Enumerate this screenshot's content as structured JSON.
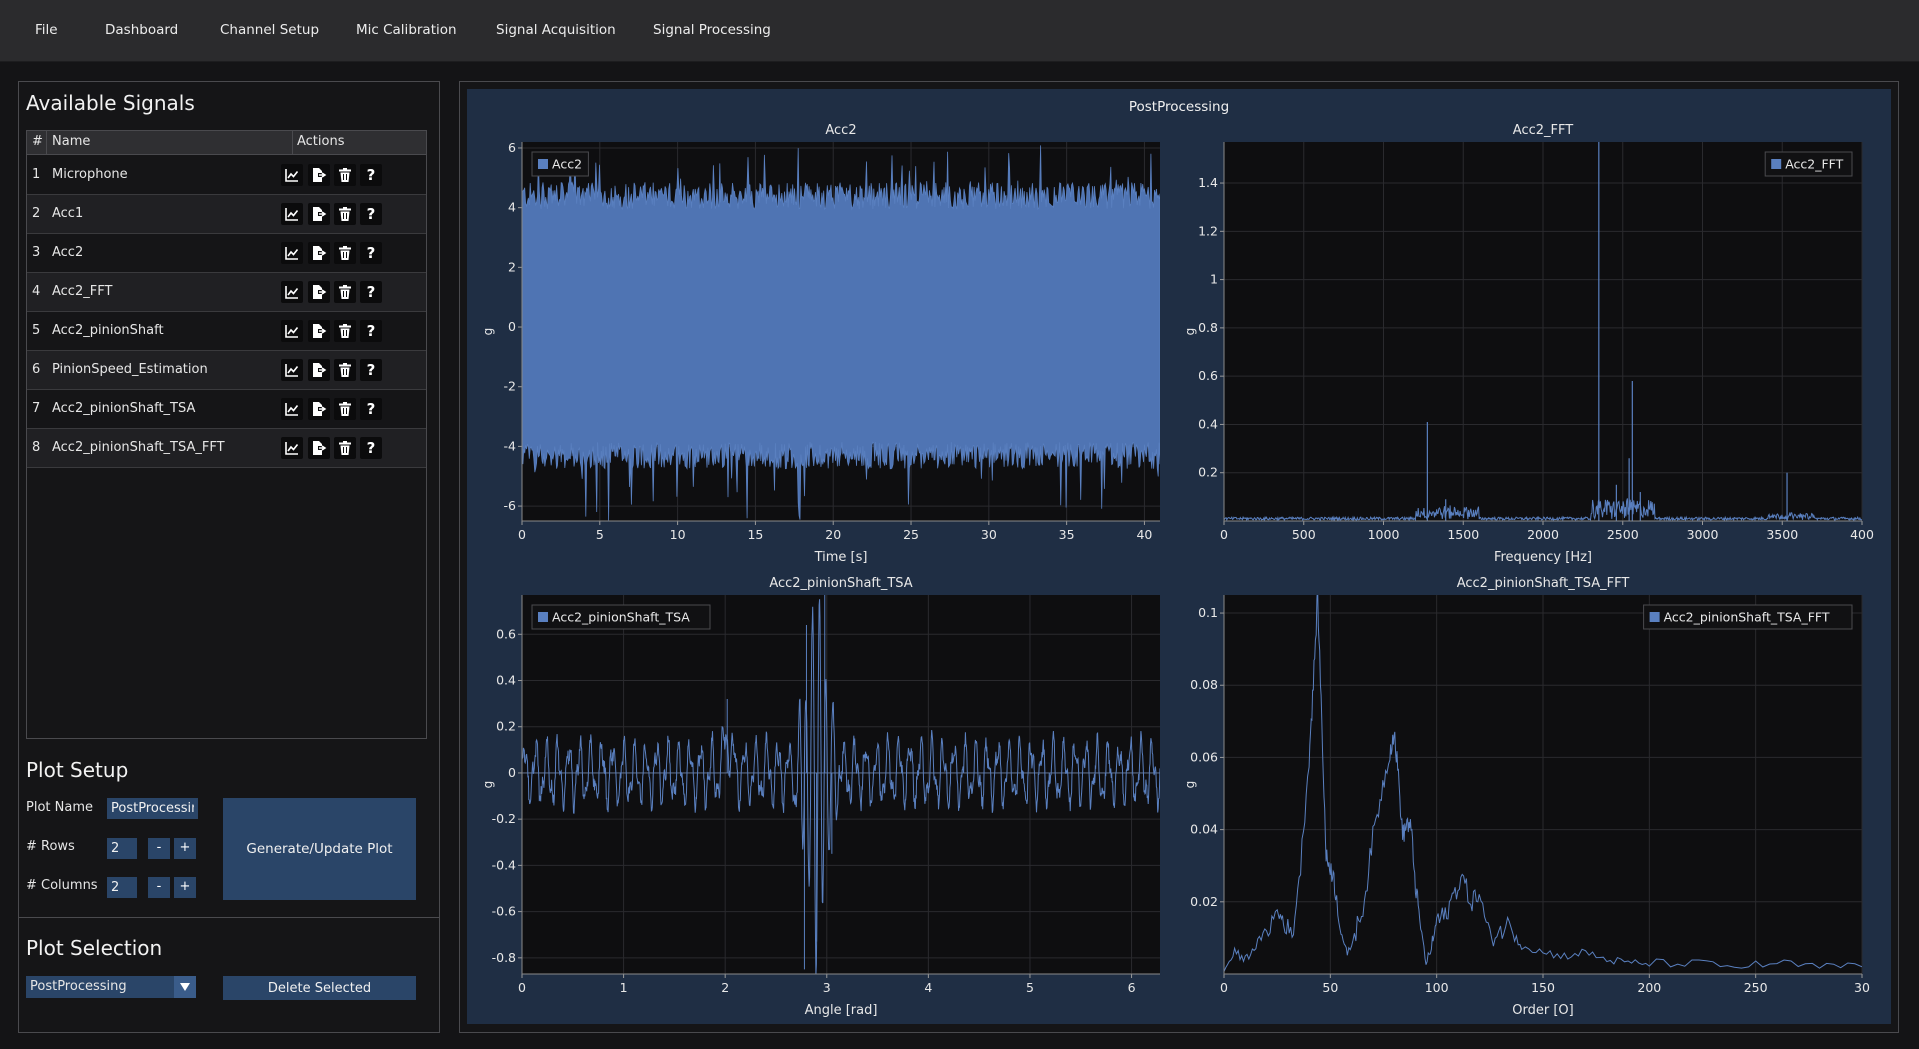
{
  "menu": [
    "File",
    "Dashboard",
    "Channel Setup",
    "Mic Calibration",
    "Signal Acquisition",
    "Signal Processing"
  ],
  "signals": {
    "title": "Available Signals",
    "columns": {
      "num": "#",
      "name": "Name",
      "actions": "Actions"
    },
    "rows": [
      {
        "idx": "1",
        "name": "Microphone"
      },
      {
        "idx": "2",
        "name": "Acc1"
      },
      {
        "idx": "3",
        "name": "Acc2"
      },
      {
        "idx": "4",
        "name": "Acc2_FFT"
      },
      {
        "idx": "5",
        "name": "Acc2_pinionShaft"
      },
      {
        "idx": "6",
        "name": "PinionSpeed_Estimation"
      },
      {
        "idx": "7",
        "name": "Acc2_pinionShaft_TSA"
      },
      {
        "idx": "8",
        "name": "Acc2_pinionShaft_TSA_FFT"
      }
    ],
    "action_icons": [
      "chart-line-icon",
      "file-export-icon",
      "trash-icon",
      "help-icon"
    ],
    "help_glyph": "?"
  },
  "plot_setup": {
    "title": "Plot Setup",
    "plot_name_label": "Plot Name",
    "plot_name_value": "PostProcessing",
    "rows_label": "# Rows",
    "rows_value": "2",
    "cols_label": "# Columns",
    "cols_value": "2",
    "minus": "-",
    "plus": "+",
    "generate_label": "Generate/Update Plot"
  },
  "plot_selection": {
    "title": "Plot Selection",
    "selected": "PostProcessing",
    "delete_label": "Delete Selected"
  },
  "figure_title": "PostProcessing",
  "colors": {
    "series": "#5a80c0",
    "fill": "#4f74b3",
    "bg": "#0e0e10",
    "panel": "#1f2e44",
    "button": "#2a4568"
  },
  "chart_data": [
    {
      "type": "area",
      "title": "Acc2",
      "xlabel": "Time [s]",
      "ylabel": "g",
      "legend": "Acc2",
      "legend_position": "top-left",
      "xlim": [
        0,
        41
      ],
      "ylim": [
        -6.5,
        6.2
      ],
      "xticks": [
        0,
        5,
        10,
        15,
        20,
        25,
        30,
        35,
        40
      ],
      "yticks": [
        6,
        4,
        2,
        0,
        -2,
        -4,
        -6
      ],
      "envelope": {
        "upper_typical": 4.4,
        "upper_peak": 6.1,
        "lower_typical": -4.3,
        "lower_peak": -6.3
      },
      "grid": true
    },
    {
      "type": "line",
      "title": "Acc2_FFT",
      "xlabel": "Frequency [Hz]",
      "ylabel": "g",
      "legend": "Acc2_FFT",
      "legend_position": "top-right",
      "xlim": [
        0,
        4000
      ],
      "ylim": [
        0,
        1.57
      ],
      "xticks": [
        0,
        500,
        1000,
        1500,
        2000,
        2500,
        3000,
        3500,
        "400"
      ],
      "yticks": [
        1.4,
        1.2,
        1,
        0.8,
        0.6,
        0.4,
        0.2
      ],
      "peaks": [
        {
          "x": 1275,
          "y": 0.41
        },
        {
          "x": 1390,
          "y": 0.09
        },
        {
          "x": 2350,
          "y": 1.57
        },
        {
          "x": 2460,
          "y": 0.15
        },
        {
          "x": 2540,
          "y": 0.26
        },
        {
          "x": 2560,
          "y": 0.58
        },
        {
          "x": 2610,
          "y": 0.12
        },
        {
          "x": 3530,
          "y": 0.2
        }
      ],
      "grid": true
    },
    {
      "type": "line",
      "title": "Acc2_pinionShaft_TSA",
      "xlabel": "Angle [rad]",
      "ylabel": "g",
      "legend": "Acc2_pinionShaft_TSA",
      "legend_position": "top-left",
      "xlim": [
        0,
        6.28
      ],
      "ylim": [
        -0.87,
        0.77
      ],
      "xticks": [
        0,
        1,
        2,
        3,
        4,
        5,
        6
      ],
      "yticks": [
        0.6,
        0.4,
        0.2,
        0,
        -0.2,
        -0.4,
        -0.6,
        -0.8
      ],
      "key_points": [
        {
          "x": 2.02,
          "y": 0.32
        },
        {
          "x": 2.78,
          "y": -0.85
        },
        {
          "x": 2.8,
          "y": 0.64
        },
        {
          "x": 2.9,
          "y": -0.73
        },
        {
          "x": 2.98,
          "y": 0.77
        },
        {
          "x": 3.05,
          "y": -0.35
        }
      ],
      "grid": true
    },
    {
      "type": "line",
      "title": "Acc2_pinionShaft_TSA_FFT",
      "xlabel": "Order [O]",
      "ylabel": "g",
      "legend": "Acc2_pinionShaft_TSA_FFT",
      "legend_position": "top-right",
      "xlim": [
        0,
        300
      ],
      "ylim": [
        0,
        0.105
      ],
      "xticks": [
        0,
        50,
        100,
        150,
        200,
        250,
        "30"
      ],
      "yticks": [
        0.1,
        0.08,
        0.06,
        0.04,
        0.02
      ],
      "x": [
        0,
        5,
        10,
        15,
        20,
        25,
        28,
        32,
        36,
        40,
        42,
        44,
        46,
        48,
        50,
        52,
        55,
        58,
        62,
        66,
        70,
        74,
        78,
        80,
        82,
        84,
        86,
        88,
        90,
        92,
        95,
        98,
        100,
        104,
        108,
        112,
        116,
        120,
        125,
        130,
        135,
        140,
        150,
        160,
        170,
        180,
        190,
        200,
        220,
        240,
        260,
        280,
        300
      ],
      "y": [
        0.001,
        0.006,
        0.004,
        0.008,
        0.012,
        0.017,
        0.015,
        0.01,
        0.03,
        0.06,
        0.08,
        0.105,
        0.07,
        0.032,
        0.03,
        0.025,
        0.012,
        0.005,
        0.012,
        0.02,
        0.038,
        0.05,
        0.062,
        0.067,
        0.055,
        0.038,
        0.042,
        0.04,
        0.025,
        0.015,
        0.003,
        0.008,
        0.015,
        0.016,
        0.022,
        0.027,
        0.02,
        0.022,
        0.01,
        0.012,
        0.014,
        0.008,
        0.006,
        0.005,
        0.006,
        0.004,
        0.003,
        0.003,
        0.003,
        0.002,
        0.003,
        0.002,
        0.002
      ],
      "grid": true
    }
  ]
}
